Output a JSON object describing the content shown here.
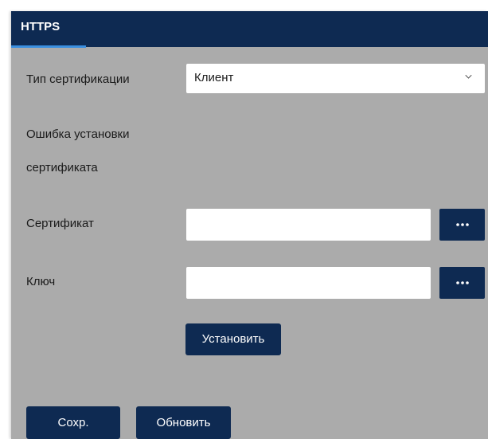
{
  "header": {
    "tab_label": "HTTPS"
  },
  "form": {
    "cert_type_label": "Тип сертификации",
    "cert_type_value": "Клиент",
    "error_line1": "Ошибка установки",
    "error_line2": "сертификата",
    "certificate_label": "Сертификат",
    "certificate_value": "",
    "key_label": "Ключ",
    "key_value": "",
    "install_button": "Установить"
  },
  "footer": {
    "save_button": "Сохр.",
    "refresh_button": "Обновить"
  },
  "icons": {
    "browse": "more-dots-icon",
    "dropdown": "chevron-down-icon"
  },
  "colors": {
    "primary": "#0e2a52",
    "panel_bg": "#ababab",
    "tab_accent": "#3a8fe0"
  }
}
